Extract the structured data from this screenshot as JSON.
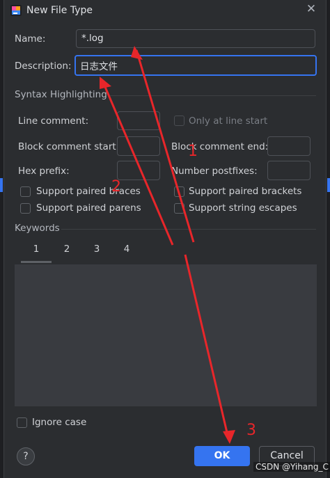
{
  "window": {
    "title": "New File Type",
    "close_icon": "close-icon"
  },
  "form": {
    "name_label": "Name:",
    "name_value": "*.log",
    "description_label": "Description:",
    "description_value": "日志文件"
  },
  "syntax": {
    "heading": "Syntax Highlighting",
    "line_comment_label": "Line comment:",
    "only_at_line_start_label": "Only at line start",
    "block_comment_start_label": "Block comment start:",
    "block_comment_end_label": "Block comment end:",
    "hex_prefix_label": "Hex prefix:",
    "number_postfixes_label": "Number postfixes:",
    "support_paired_braces": "Support paired braces",
    "support_paired_brackets": "Support paired brackets",
    "support_paired_parens": "Support paired parens",
    "support_string_escapes": "Support string escapes"
  },
  "keywords": {
    "heading": "Keywords",
    "tabs": [
      "1",
      "2",
      "3",
      "4"
    ],
    "active_tab": "1",
    "ignore_case_label": "Ignore case"
  },
  "buttons": {
    "help": "?",
    "ok": "OK",
    "cancel": "Cancel"
  },
  "annotations": {
    "n1": "1",
    "n2": "2",
    "n3": "3",
    "color": "#e8262a"
  },
  "watermark": "CSDN @Yihang_C",
  "colors": {
    "accent": "#3574f0",
    "background": "#2b2d30"
  }
}
